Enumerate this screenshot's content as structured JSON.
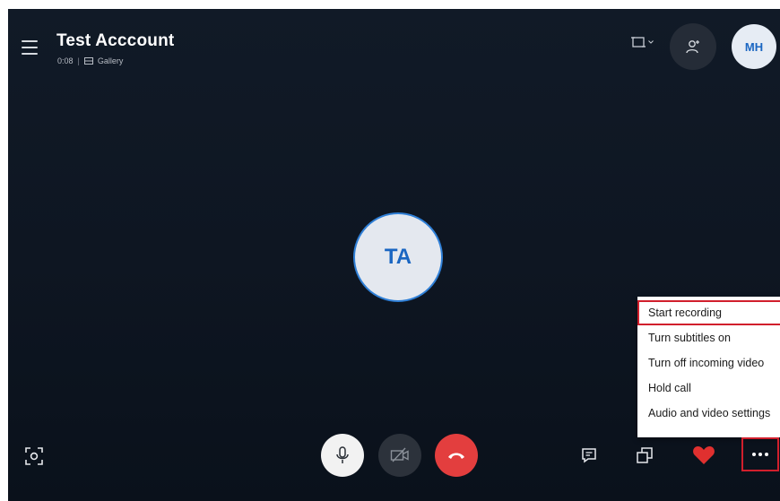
{
  "call": {
    "title": "Test Acccount",
    "duration": "0:08",
    "separator": "|",
    "view_mode": "Gallery"
  },
  "participants": {
    "self_initials": "MH",
    "remote_initials": "TA"
  },
  "more_menu": {
    "items": [
      "Start recording",
      "Turn subtitles on",
      "Turn off incoming video",
      "Hold call",
      "Audio and video settings"
    ]
  },
  "icons": {
    "menu": "hamburger-icon",
    "gallery": "gallery-icon",
    "layout": "layout-icon",
    "add_people": "add-people-icon",
    "screen_share": "screen-share-icon",
    "mic": "microphone-icon",
    "camera": "camera-off-icon",
    "end_call": "end-call-icon",
    "chat": "chat-icon",
    "switch": "switch-view-icon",
    "react": "heart-icon",
    "more": "more-icon"
  },
  "colors": {
    "end_call": "#e33e3e",
    "heart": "#e0302f",
    "highlight": "#d11f2c",
    "avatar_text": "#1a66c2"
  }
}
